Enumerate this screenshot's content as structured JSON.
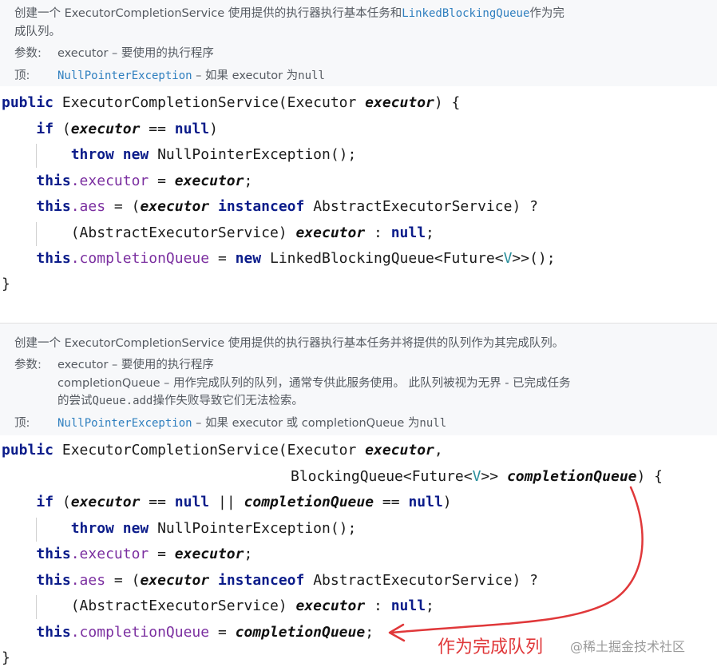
{
  "doc1": {
    "desc_line1_a": "创建一个 ExecutorCompletionService 使用提供的执行器执行基本任务和",
    "desc_line1_link": "LinkedBlockingQueue",
    "desc_line1_b": "作为完",
    "desc_line2": "成队列。",
    "params_label": "参数:",
    "param1": "executor – 要使用的执行程序",
    "throws_label": "顶:",
    "throws_link": "NullPointerException",
    "throws_text": " – 如果 executor 为",
    "throws_null": "null"
  },
  "code1": {
    "l1_public": "public",
    "l1_name": " ExecutorCompletionService(Executor ",
    "l1_param": "executor",
    "l1_end": ") {",
    "l2_if": "if",
    "l2_open": " (",
    "l2_param": "executor",
    "l2_op": " == ",
    "l2_null": "null",
    "l2_close": ")",
    "l3_throw": "throw",
    "l3_new": " new",
    "l3_rest": " NullPointerException();",
    "l4_this": "this",
    "l4_field": ".executor",
    "l4_eq": " = ",
    "l4_param": "executor",
    "l4_semi": ";",
    "l5_this": "this",
    "l5_field": ".aes",
    "l5_eq": " = (",
    "l5_param": "executor",
    "l5_inst": " instanceof",
    "l5_rest": " AbstractExecutorService) ?",
    "l6_cast": "(AbstractExecutorService) ",
    "l6_param": "executor",
    "l6_colon": " : ",
    "l6_null": "null",
    "l6_semi": ";",
    "l7_this": "this",
    "l7_field": ".completionQueue",
    "l7_eq": " = ",
    "l7_new": "new",
    "l7_type": " LinkedBlockingQueue<Future<",
    "l7_v": "V",
    "l7_end": ">>();",
    "l8_brace": "}"
  },
  "doc2": {
    "desc": "创建一个 ExecutorCompletionService 使用提供的执行器执行基本任务并将提供的队列作为其完成队列。",
    "params_label": "参数:",
    "param1": "executor – 要使用的执行程序",
    "param2_line1": "completionQueue – 用作完成队列的队列，通常专供此服务使用。 此队列被视为无界 - 已完成任务",
    "param2_line2_a": "的尝试",
    "param2_line2_code": "Queue.add",
    "param2_line2_b": "操作失败导致它们无法检索。",
    "throws_label": "顶:",
    "throws_link": "NullPointerException",
    "throws_text": " – 如果 executor 或 completionQueue 为",
    "throws_null": "null"
  },
  "code2": {
    "l1_public": "public",
    "l1_name": " ExecutorCompletionService(Executor ",
    "l1_param": "executor",
    "l1_comma": ",",
    "l2_type": "BlockingQueue<Future<",
    "l2_v": "V",
    "l2_close": ">> ",
    "l2_param": "completionQueue",
    "l2_end": ") {",
    "l3_if": "if",
    "l3_open": " (",
    "l3_p1": "executor",
    "l3_op": " == ",
    "l3_null1": "null",
    "l3_or": " || ",
    "l3_p2": "completionQueue",
    "l3_op2": " == ",
    "l3_null2": "null",
    "l3_close": ")",
    "l4_throw": "throw",
    "l4_new": " new",
    "l4_rest": " NullPointerException();",
    "l5_this": "this",
    "l5_field": ".executor",
    "l5_eq": " = ",
    "l5_param": "executor",
    "l5_semi": ";",
    "l6_this": "this",
    "l6_field": ".aes",
    "l6_eq": " = (",
    "l6_param": "executor",
    "l6_inst": " instanceof",
    "l6_rest": " AbstractExecutorService) ?",
    "l7_cast": "(AbstractExecutorService) ",
    "l7_param": "executor",
    "l7_colon": " : ",
    "l7_null": "null",
    "l7_semi": ";",
    "l8_this": "this",
    "l8_field": ".completionQueue",
    "l8_eq": " = ",
    "l8_param": "completionQueue",
    "l8_semi": ";",
    "l9_brace": "}"
  },
  "annotation": {
    "text": "作为完成队列",
    "color": "#e0383a"
  },
  "watermark": {
    "text": "@稀土掘金技术社区"
  },
  "colors": {
    "keyword": "#0b1c8a",
    "field": "#7b2fa0",
    "link": "#2f7fbf",
    "type_param": "#2a8f9c",
    "doc_bg": "#f7f8fa"
  }
}
